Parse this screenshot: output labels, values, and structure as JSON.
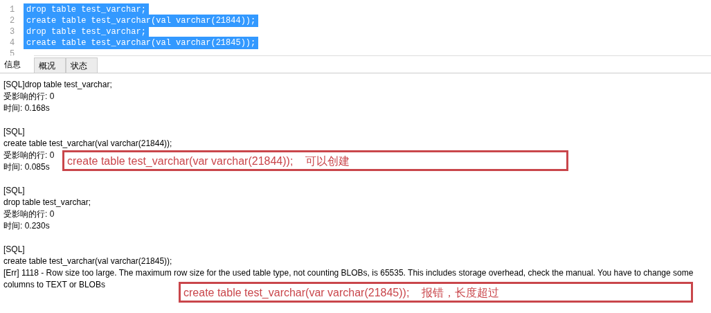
{
  "editor": {
    "lines": [
      {
        "number": "1",
        "text": "drop table test_varchar;",
        "selected": true
      },
      {
        "number": "2",
        "text": "create table test_varchar(val varchar(21844));",
        "selected": true
      },
      {
        "number": "3",
        "text": "drop table test_varchar;",
        "selected": true
      },
      {
        "number": "4",
        "text": "create table test_varchar(val varchar(21845));",
        "selected": true
      },
      {
        "number": "5"
      }
    ]
  },
  "tabs": [
    {
      "label": "信息",
      "selected": true
    },
    {
      "label": "概况",
      "selected": false
    },
    {
      "label": "状态",
      "selected": false
    }
  ],
  "messages": [
    {
      "lines": [
        "[SQL]drop table test_varchar;",
        "受影响的行: 0",
        "时间: 0.168s"
      ]
    },
    {
      "lines": [
        "[SQL]",
        "create table test_varchar(val varchar(21844));",
        "受影响的行: 0",
        "时间: 0.085s"
      ]
    },
    {
      "lines": [
        "[SQL]",
        "drop table test_varchar;",
        "受影响的行: 0",
        "时间: 0.230s"
      ]
    },
    {
      "lines": [
        "[SQL]",
        "create table test_varchar(val varchar(21845));",
        "[Err] 1118 - Row size too large. The maximum row size for the used table type, not counting BLOBs, is 65535. This includes storage overhead, check the manual. You have to change some columns to TEXT or BLOBs"
      ]
    }
  ],
  "annotations": [
    {
      "code": "create table test_varchar(var varchar(21844));",
      "note": "可以创建"
    },
    {
      "code": "create table test_varchar(var varchar(21845));",
      "note": "报错，长度超过"
    }
  ]
}
